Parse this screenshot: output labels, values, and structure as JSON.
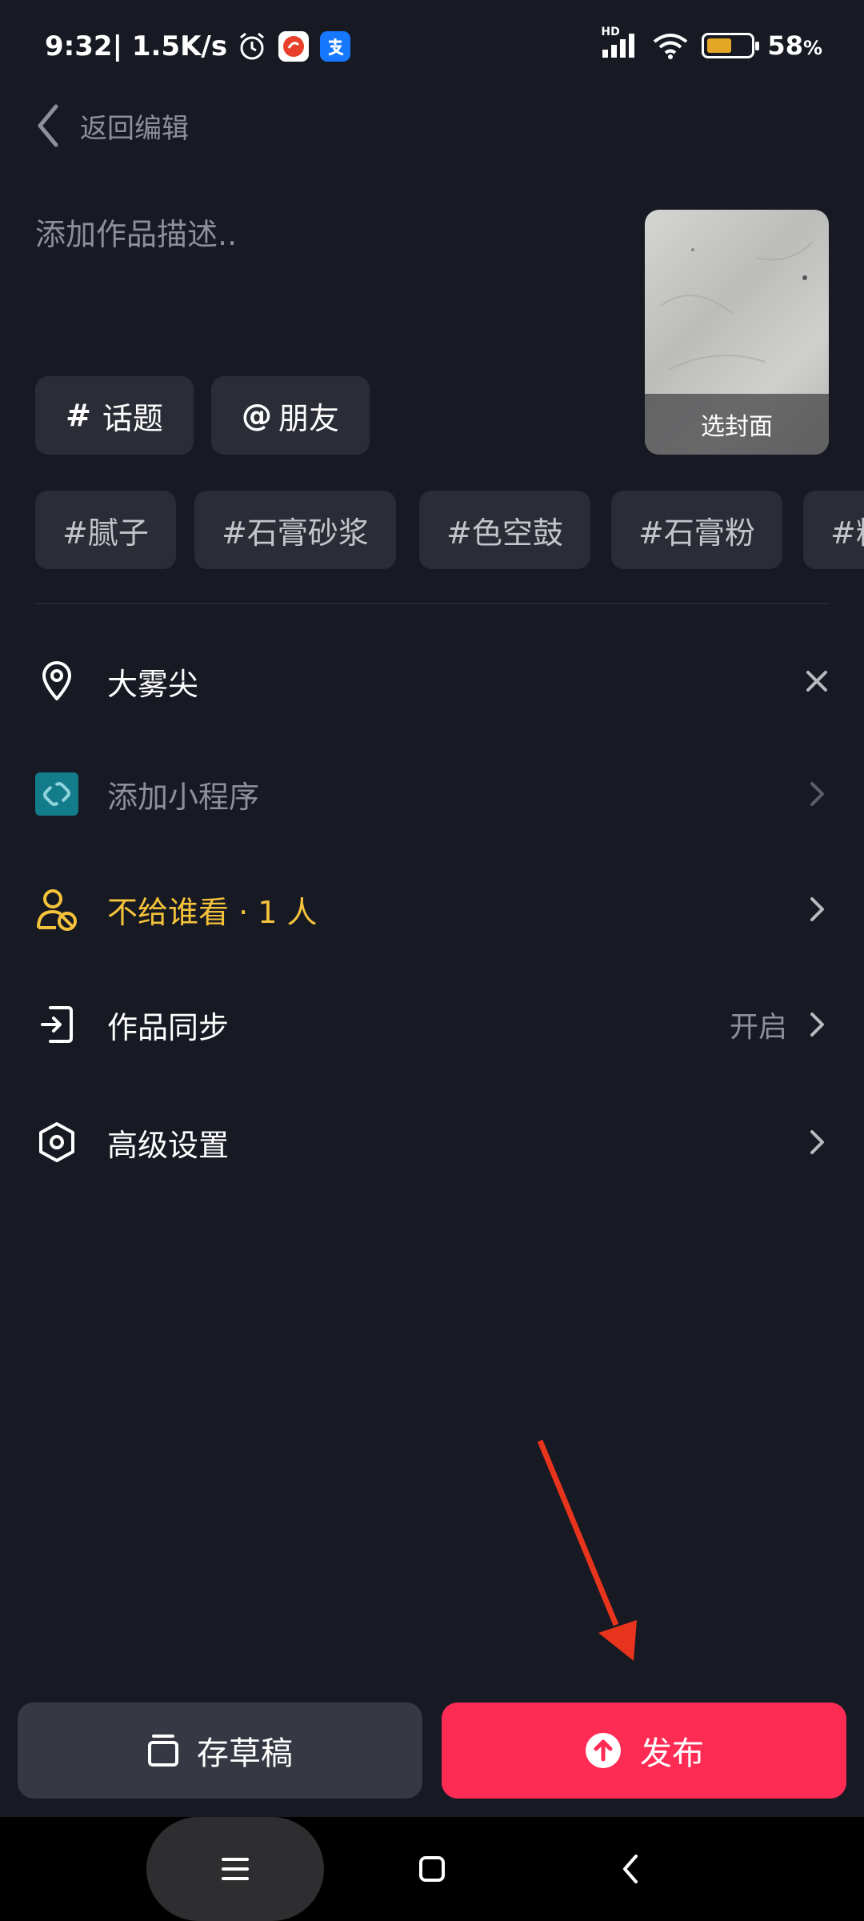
{
  "status_bar": {
    "time": "9:32",
    "speed": " | 1.5K/s",
    "network": "HD",
    "battery_percent": "58",
    "battery_unit": "%",
    "battery_level": 0.58
  },
  "header": {
    "back_label": "返回编辑"
  },
  "description": {
    "placeholder": "添加作品描述.."
  },
  "cover": {
    "label": "选封面"
  },
  "chips": {
    "topic_icon": "#",
    "topic_label": "话题",
    "friend_icon": "@",
    "friend_label": "朋友"
  },
  "tags": [
    "#腻子",
    "#石膏砂浆",
    "#色空鼓",
    "#石膏粉",
    "#粉"
  ],
  "settings": {
    "location": {
      "label": "大雾尖",
      "icon": "location-pin-icon"
    },
    "mini_program": {
      "label": "添加小程序",
      "icon": "mini-program-icon"
    },
    "privacy": {
      "label": "不给谁看 · 1 人",
      "icon": "user-block-icon"
    },
    "sync": {
      "label": "作品同步",
      "value": "开启",
      "icon": "sync-icon"
    },
    "advanced": {
      "label": "高级设置",
      "icon": "hexagon-settings-icon"
    }
  },
  "buttons": {
    "draft_label": "存草稿",
    "publish_label": "发布"
  },
  "colors": {
    "background": "#171923",
    "accent": "#fe2c55",
    "warning": "#f5c33b",
    "chip": "#2a2c36",
    "battery": "#e5a626"
  }
}
